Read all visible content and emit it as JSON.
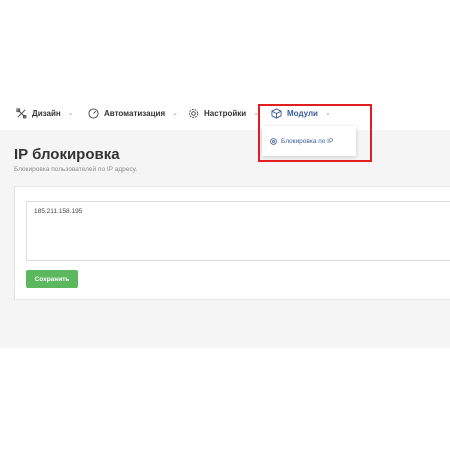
{
  "nav": {
    "items": [
      {
        "label": "Дизайн",
        "icon": "design-tools-icon"
      },
      {
        "label": "Автоматизация",
        "icon": "automation-gauge-icon"
      },
      {
        "label": "Настройки",
        "icon": "gear-icon"
      },
      {
        "label": "Модули",
        "icon": "cube-icon"
      }
    ],
    "chevron": "⌄"
  },
  "dropdown": {
    "item_label": "Блокировка по IP",
    "icon": "target-icon"
  },
  "page": {
    "title": "IP блокировка",
    "subtitle": "Блокировка пользователей по IP адресу."
  },
  "form": {
    "ip_list_value": "185.211.158.195",
    "save_label": "Сохранить"
  },
  "colors": {
    "accent": "#3c5a99",
    "highlight": "#e02020",
    "save_button": "#5cb85c",
    "content_bg": "#f5f5f5"
  }
}
